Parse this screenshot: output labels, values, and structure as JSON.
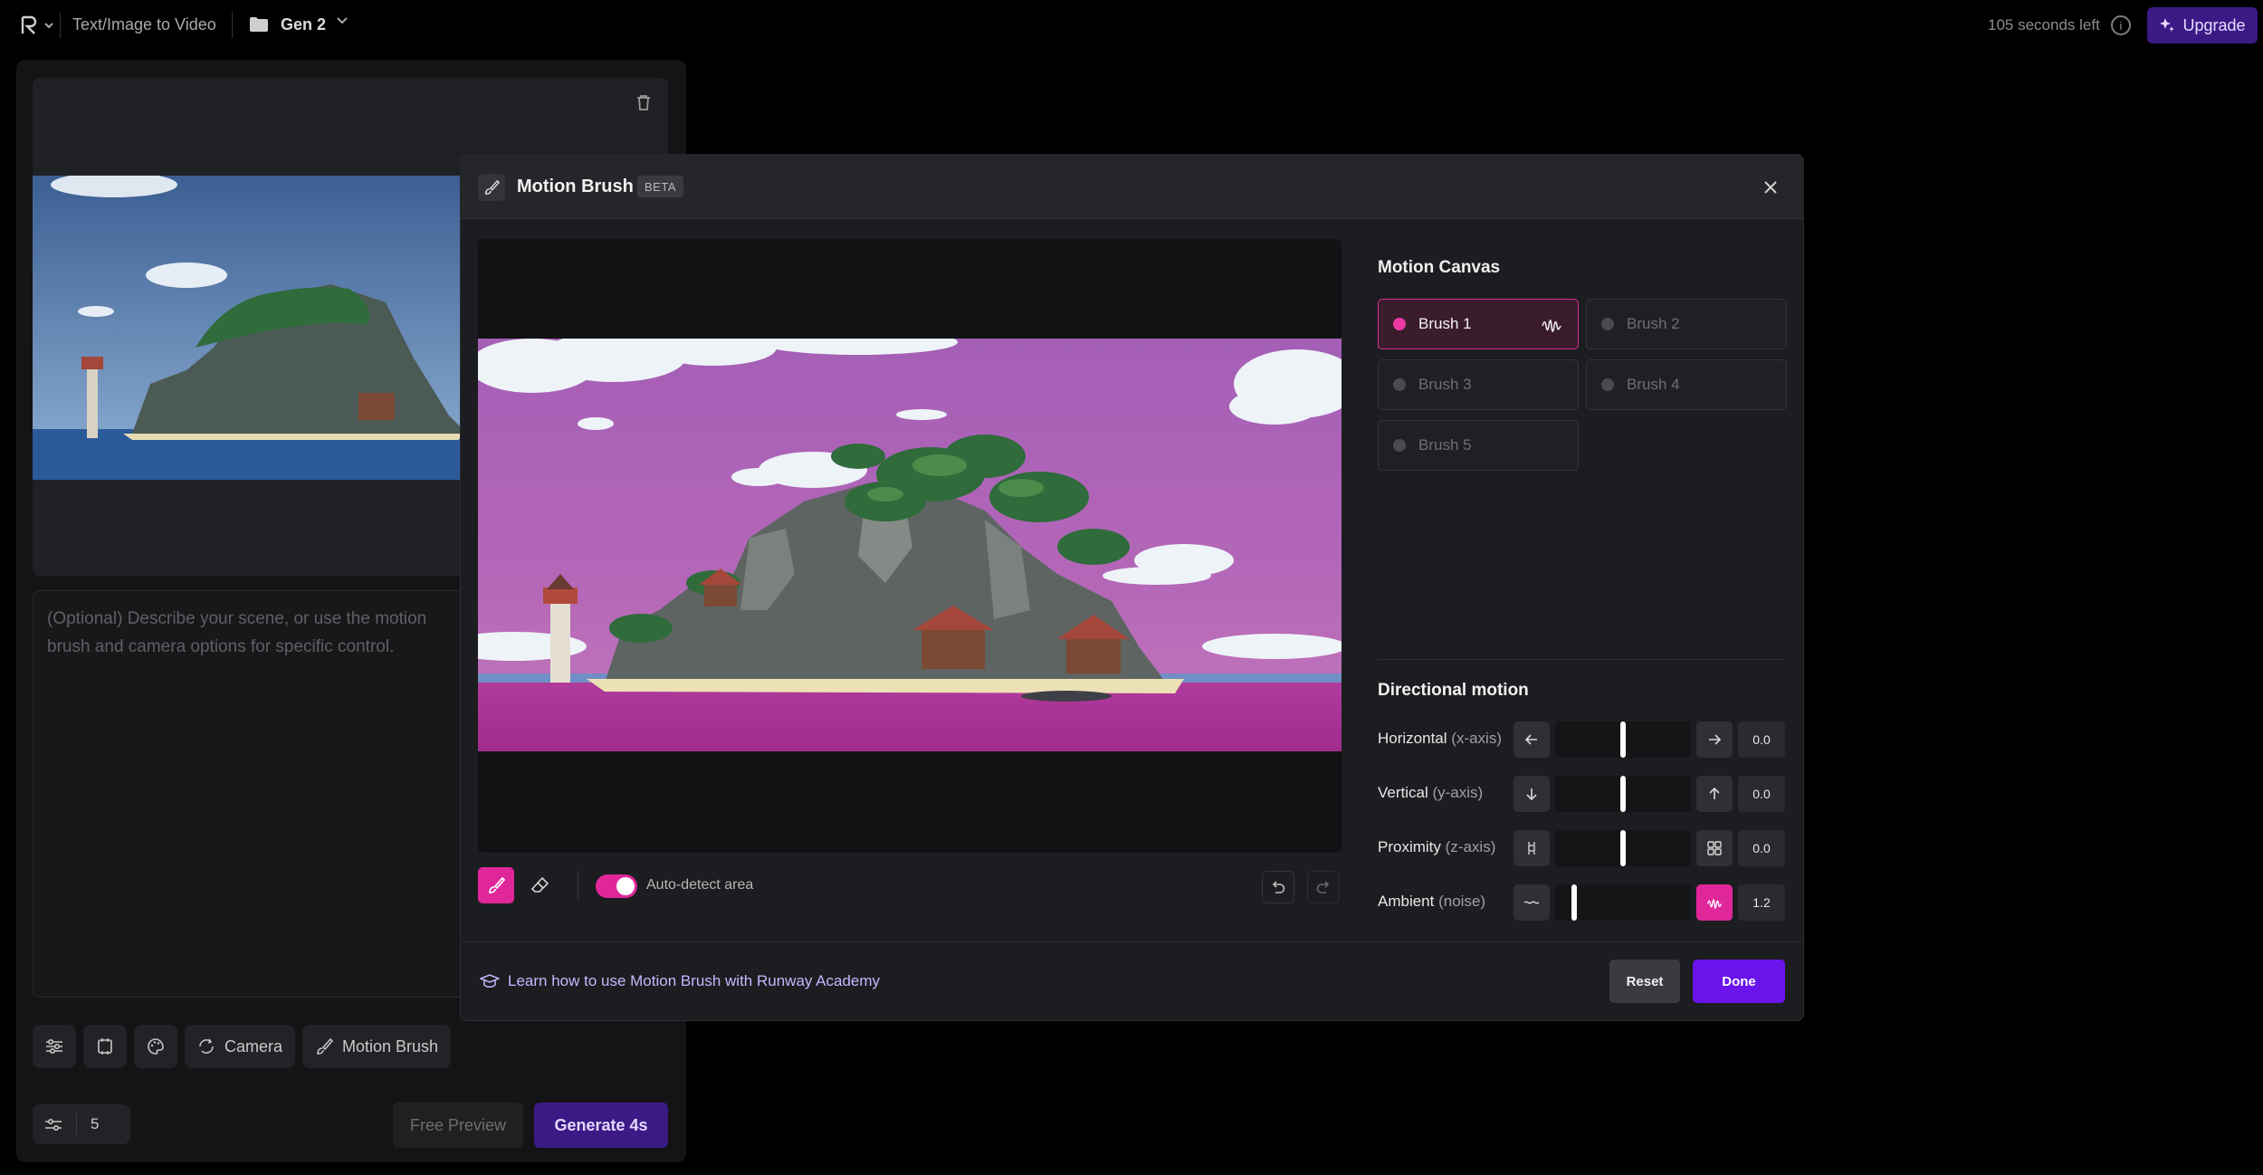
{
  "topbar": {
    "app_title": "Text/Image to Video",
    "project_name": "Gen 2",
    "time_left": "105 seconds left",
    "upgrade_label": "Upgrade"
  },
  "left_panel": {
    "prompt_placeholder": "(Optional) Describe your scene, or use the motion brush and camera options for specific control.",
    "tools": {
      "camera_label": "Camera",
      "motion_brush_label": "Motion Brush"
    },
    "seed_value": "5",
    "free_preview_label": "Free Preview",
    "generate_label": "Generate 4s"
  },
  "modal": {
    "title": "Motion Brush",
    "badge": "BETA",
    "auto_detect_label": "Auto-detect area",
    "auto_detect_on": true,
    "academy_link": "Learn how to use Motion Brush with Runway Academy",
    "reset_label": "Reset",
    "done_label": "Done",
    "motion_canvas": {
      "title": "Motion Canvas",
      "brushes": [
        {
          "label": "Brush 1",
          "active": true
        },
        {
          "label": "Brush 2",
          "active": false
        },
        {
          "label": "Brush 3",
          "active": false
        },
        {
          "label": "Brush 4",
          "active": false
        },
        {
          "label": "Brush 5",
          "active": false
        }
      ]
    },
    "directional_motion": {
      "title": "Directional motion",
      "rows": [
        {
          "label": "Horizontal",
          "sub": "(x-axis)",
          "value": "0.0"
        },
        {
          "label": "Vertical",
          "sub": "(y-axis)",
          "value": "0.0"
        },
        {
          "label": "Proximity",
          "sub": "(z-axis)",
          "value": "0.0"
        },
        {
          "label": "Ambient",
          "sub": "(noise)",
          "value": "1.2"
        }
      ]
    }
  },
  "colors": {
    "accent_pink": "#e0279a",
    "accent_purple": "#6a13ea",
    "upgrade_bg": "#3b1a86"
  }
}
